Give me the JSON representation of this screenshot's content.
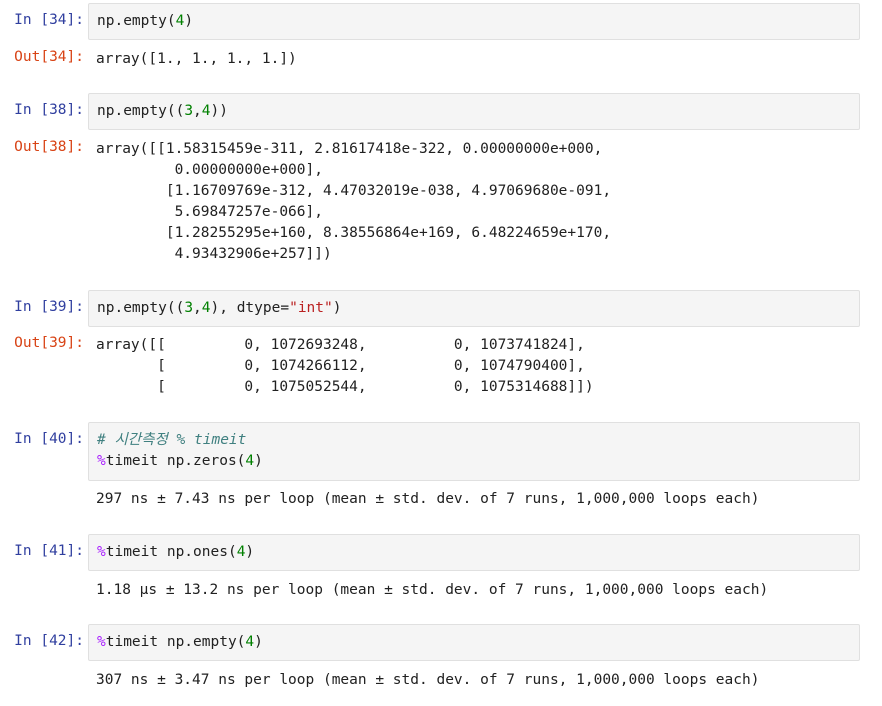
{
  "cells": [
    {
      "in_prompt": "In [34]:",
      "code": {
        "pre": "np.empty(",
        "num": "4",
        "post": ")"
      },
      "out_prompt": "Out[34]:",
      "output": "array([1., 1., 1., 1.])"
    },
    {
      "in_prompt": "In [38]:",
      "code": {
        "pre": "np.empty((",
        "num1": "3",
        "mid": ",",
        "num2": "4",
        "post": "))"
      },
      "out_prompt": "Out[38]:",
      "output": "array([[1.58315459e-311, 2.81617418e-322, 0.00000000e+000,\n         0.00000000e+000],\n        [1.16709769e-312, 4.47032019e-038, 4.97069680e-091,\n         5.69847257e-066],\n        [1.28255295e+160, 8.38556864e+169, 6.48224659e+170,\n         4.93432906e+257]])"
    },
    {
      "in_prompt": "In [39]:",
      "code": {
        "pre": "np.empty((",
        "num1": "3",
        "mid": ",",
        "num2": "4",
        "mid2": "), dtype=",
        "str": "\"int\"",
        "post": ")"
      },
      "out_prompt": "Out[39]:",
      "output": "array([[         0, 1072693248,          0, 1073741824],\n       [         0, 1074266112,          0, 1074790400],\n       [         0, 1075052544,          0, 1075314688]])"
    },
    {
      "in_prompt": "In [40]:",
      "comment": "# 시간측정 % timeit",
      "magic": "%",
      "code": {
        "pre": "timeit np.zeros(",
        "num": "4",
        "post": ")"
      },
      "output": "297 ns ± 7.43 ns per loop (mean ± std. dev. of 7 runs, 1,000,000 loops each)"
    },
    {
      "in_prompt": "In [41]:",
      "magic": "%",
      "code": {
        "pre": "timeit np.ones(",
        "num": "4",
        "post": ")"
      },
      "output": "1.18 µs ± 13.2 ns per loop (mean ± std. dev. of 7 runs, 1,000,000 loops each)"
    },
    {
      "in_prompt": "In [42]:",
      "magic": "%",
      "code": {
        "pre": "timeit np.empty(",
        "num": "4",
        "post": ")"
      },
      "output": "307 ns ± 3.47 ns per loop (mean ± std. dev. of 7 runs, 1,000,000 loops each)"
    }
  ]
}
